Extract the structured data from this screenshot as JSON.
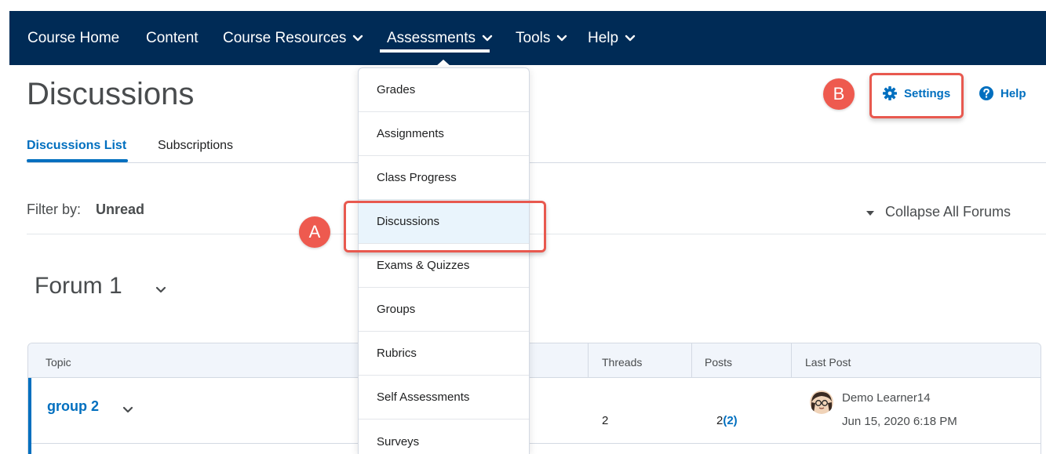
{
  "nav": {
    "items": [
      {
        "label": "Course Home",
        "has_menu": false
      },
      {
        "label": "Content",
        "has_menu": false
      },
      {
        "label": "Course Resources",
        "has_menu": true
      },
      {
        "label": "Assessments",
        "has_menu": true,
        "open": true
      },
      {
        "label": "Tools",
        "has_menu": true
      },
      {
        "label": "Help",
        "has_menu": true
      }
    ]
  },
  "dropdown": {
    "items": [
      {
        "label": "Grades"
      },
      {
        "label": "Assignments"
      },
      {
        "label": "Class Progress"
      },
      {
        "label": "Discussions",
        "selected": true
      },
      {
        "label": "Exams & Quizzes"
      },
      {
        "label": "Groups"
      },
      {
        "label": "Rubrics"
      },
      {
        "label": "Self Assessments"
      },
      {
        "label": "Surveys"
      }
    ]
  },
  "page": {
    "title": "Discussions",
    "tabs": [
      {
        "label": "Discussions List",
        "active": true
      },
      {
        "label": "Subscriptions",
        "active": false
      }
    ],
    "filter_label": "Filter by:",
    "filter_value": "Unread",
    "collapse_all": "Collapse All Forums"
  },
  "actions": {
    "settings": "Settings",
    "help": "Help"
  },
  "forum": {
    "title": "Forum 1"
  },
  "table": {
    "headers": {
      "topic": "Topic",
      "threads": "Threads",
      "posts": "Posts",
      "last_post": "Last Post"
    },
    "rows": [
      {
        "topic": "group 2",
        "threads": "2",
        "posts": "2",
        "posts_unread": "(2)",
        "last_post_author": "Demo Learner14",
        "last_post_date": "Jun 15, 2020 6:18 PM"
      }
    ]
  },
  "annotations": {
    "a": "A",
    "b": "B"
  },
  "colors": {
    "navbar": "#002b56",
    "link": "#006fbf",
    "highlight": "#e8594f",
    "badge": "#ee5a4f",
    "selected_bg": "#e9f4fc"
  }
}
